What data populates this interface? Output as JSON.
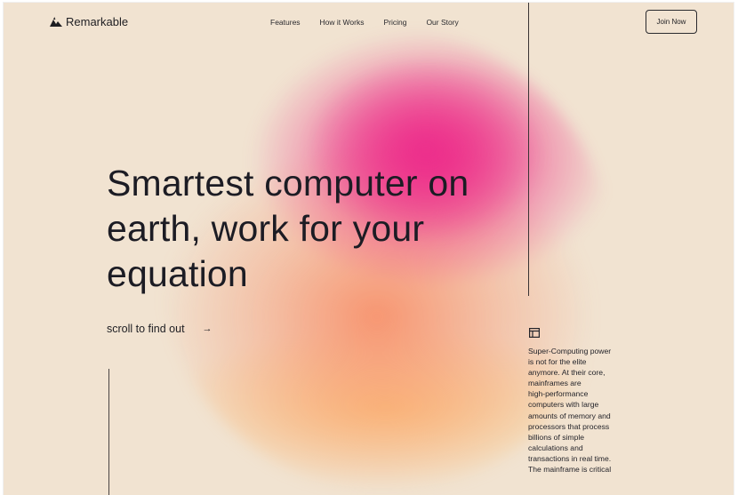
{
  "nav": {
    "logo_text": "Remarkable",
    "logo_icon": "mountain-logo-icon",
    "links": [
      "Features",
      "How it Works",
      "Pricing",
      "Our Story"
    ],
    "cta_label": "Join Now"
  },
  "hero": {
    "headline_lines": [
      "Smartest computer on",
      "earth, work for your",
      "equation"
    ],
    "scroll_label": "scroll to find out",
    "scroll_arrow": "→"
  },
  "side": {
    "icon": "window-icon",
    "text_lines": [
      "Super-Computing power",
      "is not for the elite",
      "anymore. At their core,",
      "mainframes are",
      "high-performance",
      "computers with large",
      "amounts of memory and",
      "processors that process",
      "billions of simple",
      "calculations and",
      "transactions in real time.",
      "The mainframe is critical"
    ]
  },
  "colors": {
    "background": "#f1e3d1",
    "blob_pink": "#ee2882",
    "blob_orange": "#f8875f",
    "blob_yellow": "#fcc478",
    "text": "#1c1c24"
  }
}
